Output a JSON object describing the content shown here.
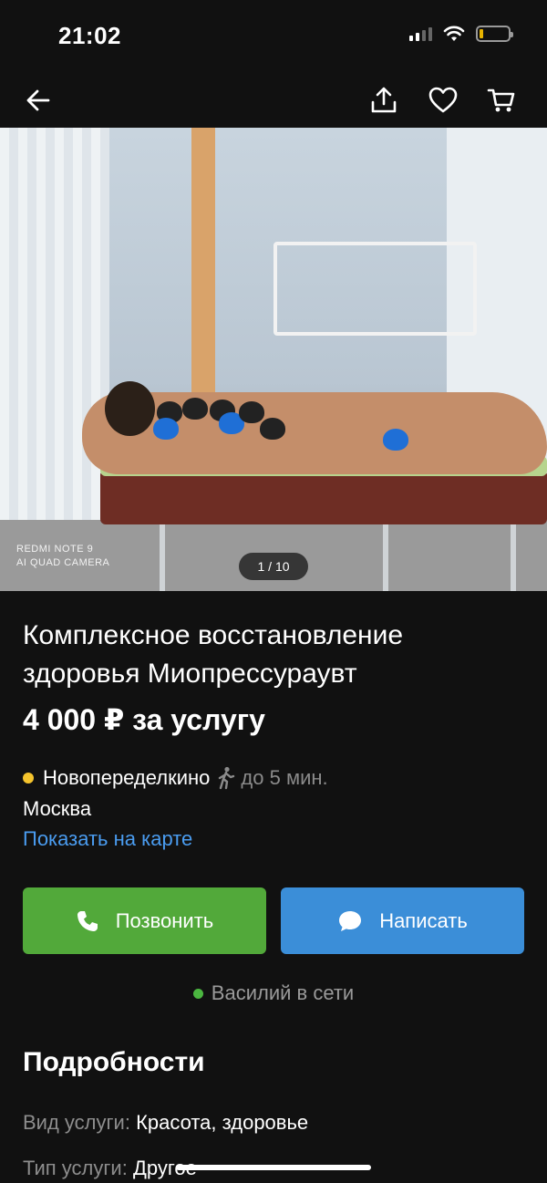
{
  "status_bar": {
    "time": "21:02"
  },
  "nav": {
    "back_icon": "arrow-left-icon",
    "share_icon": "share-icon",
    "favorite_icon": "heart-icon",
    "cart_icon": "cart-icon"
  },
  "gallery": {
    "counter": "1 / 10",
    "watermark_line1": "REDMI NOTE 9",
    "watermark_line2": "AI QUAD CAMERA"
  },
  "listing": {
    "title": "Комплексное восстановление здоровья Миопрессураувт",
    "price": "4 000 ₽ за услугу"
  },
  "location": {
    "metro_station": "Новопеределкино",
    "metro_color": "#f5c42d",
    "walk_time": "до 5 мин.",
    "city": "Москва",
    "map_link": "Показать на карте"
  },
  "actions": {
    "call_label": "Позвонить",
    "call_color": "#52a93a",
    "message_label": "Написать",
    "message_color": "#3b8ed8"
  },
  "seller": {
    "online_text": "Василий в сети"
  },
  "details": {
    "heading": "Подробности",
    "rows": [
      {
        "key": "Вид услуги:",
        "value": "Красота, здоровье"
      },
      {
        "key": "Тип услуги:",
        "value": "Другое"
      }
    ]
  }
}
